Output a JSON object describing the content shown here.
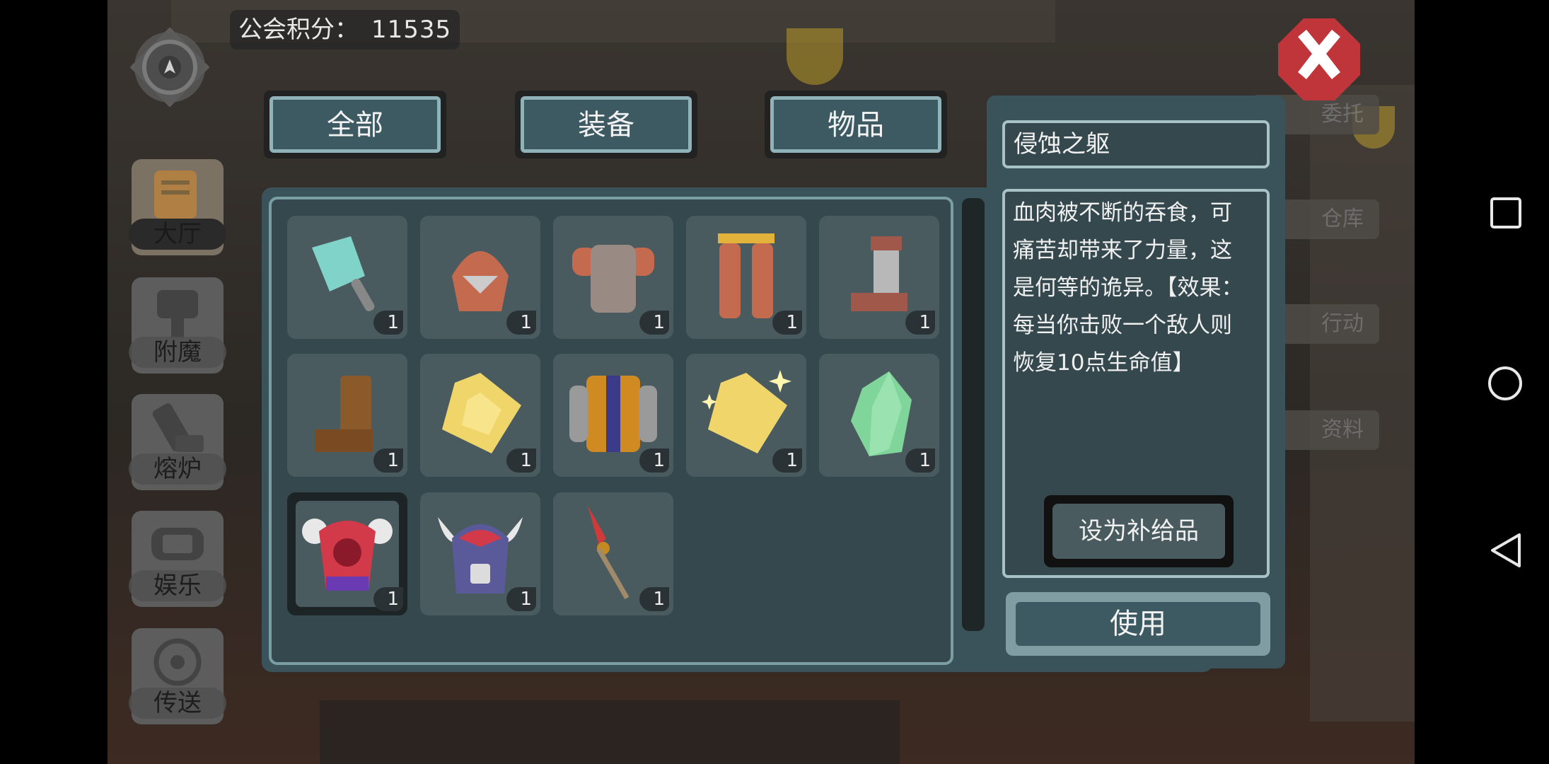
{
  "guild_points": {
    "label": "公会积分：",
    "value": "11535"
  },
  "tabs": [
    {
      "label": "全部"
    },
    {
      "label": "装备"
    },
    {
      "label": "物品"
    }
  ],
  "left_nav": [
    {
      "label": "大厅",
      "icon": "hall-icon"
    },
    {
      "label": "附魔",
      "icon": "enchant-icon"
    },
    {
      "label": "熔炉",
      "icon": "furnace-icon"
    },
    {
      "label": "娱乐",
      "icon": "entertainment-icon"
    },
    {
      "label": "传送",
      "icon": "teleport-icon"
    }
  ],
  "right_nav": [
    {
      "label": "委托"
    },
    {
      "label": "仓库"
    },
    {
      "label": "行动"
    },
    {
      "label": "资料"
    }
  ],
  "items": [
    {
      "icon": "cleaver-icon",
      "qty": "1"
    },
    {
      "icon": "helmet-icon",
      "qty": "1"
    },
    {
      "icon": "chest-armor-icon",
      "qty": "1"
    },
    {
      "icon": "leg-armor-icon",
      "qty": "1"
    },
    {
      "icon": "metal-boot-icon",
      "qty": "1"
    },
    {
      "icon": "leather-boot-icon",
      "qty": "1"
    },
    {
      "icon": "yellow-gem-icon",
      "qty": "1"
    },
    {
      "icon": "jacket-icon",
      "qty": "1"
    },
    {
      "icon": "sparkling-gem-icon",
      "qty": "1"
    },
    {
      "icon": "green-crystal-icon",
      "qty": "1"
    },
    {
      "icon": "skull-armor-icon",
      "qty": "1"
    },
    {
      "icon": "horned-helmet-icon",
      "qty": "1"
    },
    {
      "icon": "spear-icon",
      "qty": "1"
    }
  ],
  "detail": {
    "name": "侵蚀之躯",
    "description": "血肉被不断的吞食，可痛苦却带来了力量，这是何等的诡异。【效果：每当你击败一个敌人则恢复10点生命值】",
    "supply_button": "设为补给品",
    "use_button": "使用"
  },
  "colors": {
    "panel": "#3a5259",
    "slot": "#4a5b60",
    "border": "#8fb3b8"
  }
}
